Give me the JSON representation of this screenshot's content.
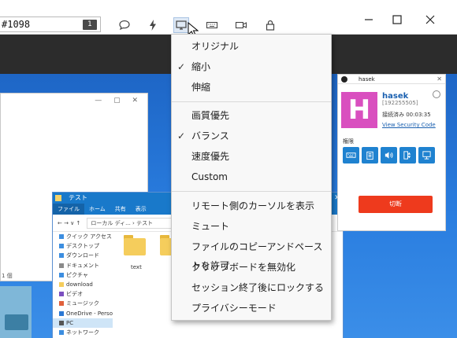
{
  "titlebar": {
    "session_id": "#1098",
    "monitor_badge": "1",
    "toolbar_icons": [
      "chat-icon",
      "lightning-icon",
      "display-icon",
      "keyboard-icon",
      "camera-icon",
      "lock-icon"
    ],
    "window_controls": [
      "minimize",
      "maximize",
      "close"
    ]
  },
  "menu": {
    "items": [
      {
        "label": "オリジナル",
        "checked": false
      },
      {
        "label": "縮小",
        "checked": true
      },
      {
        "label": "伸縮",
        "checked": false
      },
      {
        "label": "画質優先",
        "checked": false
      },
      {
        "label": "バランス",
        "checked": true
      },
      {
        "label": "速度優先",
        "checked": false
      },
      {
        "label": "Custom",
        "checked": false
      },
      {
        "label": "リモート側のカーソルを表示",
        "checked": false
      },
      {
        "label": "ミュート",
        "checked": false
      },
      {
        "label": "ファイルのコピーアンドペーストを許可",
        "checked": false
      },
      {
        "label": "クリップボードを無効化",
        "checked": false
      },
      {
        "label": "セッション終了後にロックする",
        "checked": false
      },
      {
        "label": "プライバシーモード",
        "checked": false
      }
    ],
    "check_mark": "✓"
  },
  "remote": {
    "panel": {
      "title": "hasek",
      "avatar_letter": "H",
      "name": "hasek",
      "id": "[192255505]",
      "connection": "接続済み 00:03:35",
      "security_link": "View Security Code",
      "permissions_label": "権限",
      "disconnect_label": "切断",
      "colors": {
        "avatar": "#d94fbf",
        "button": "#1f82d0",
        "disconnect": "#ee3a1d"
      }
    },
    "explorer": {
      "title": "テスト",
      "ribbon": [
        "ファイル",
        "ホーム",
        "共有",
        "表示"
      ],
      "path": "ローカル ディ... › テスト",
      "nav": [
        "クイック アクセス",
        "デスクトップ",
        "ダウンロード",
        "ドキュメント",
        "ピクチャ",
        "download",
        "ビデオ",
        "ミュージック",
        "OneDrive - Personal",
        "PC",
        "ネットワーク"
      ],
      "folder_label": "text"
    },
    "status_text": "1 個"
  }
}
